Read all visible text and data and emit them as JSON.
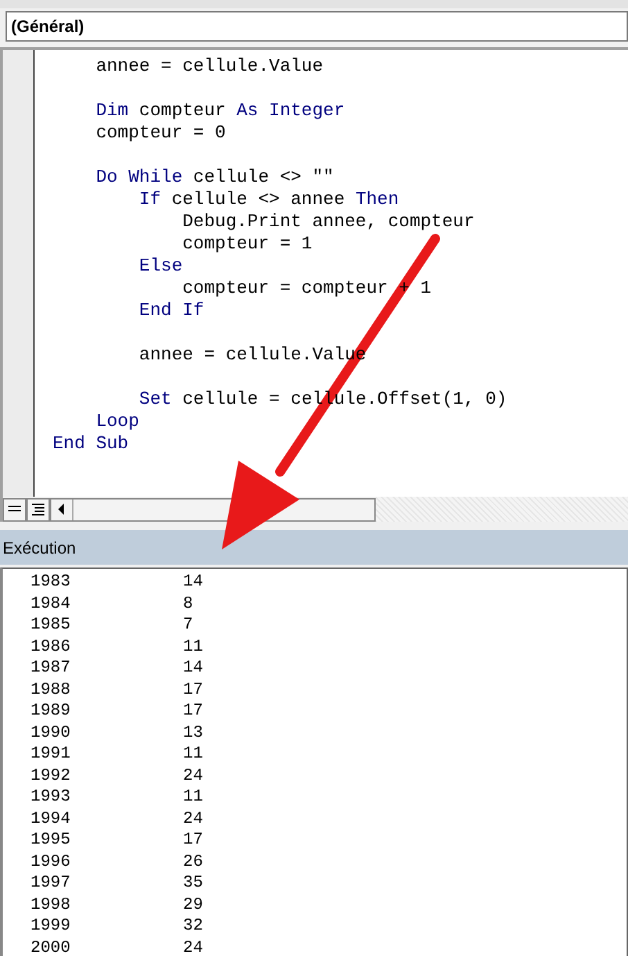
{
  "editor": {
    "procedure_dropdown": "(Général)",
    "code_lines": [
      {
        "kind": "code",
        "segments": [
          {
            "kind": "plain",
            "text": "    annee = cellule.Value"
          }
        ]
      },
      {
        "kind": "blank"
      },
      {
        "kind": "code",
        "segments": [
          {
            "kind": "keyword",
            "text": "    Dim"
          },
          {
            "kind": "plain",
            "text": " compteur "
          },
          {
            "kind": "keyword",
            "text": "As Integer"
          }
        ]
      },
      {
        "kind": "code",
        "segments": [
          {
            "kind": "plain",
            "text": "    compteur = 0"
          }
        ]
      },
      {
        "kind": "blank"
      },
      {
        "kind": "code",
        "segments": [
          {
            "kind": "keyword",
            "text": "    Do While"
          },
          {
            "kind": "plain",
            "text": " cellule <> \"\""
          }
        ]
      },
      {
        "kind": "code",
        "segments": [
          {
            "kind": "keyword",
            "text": "        If"
          },
          {
            "kind": "plain",
            "text": " cellule <> annee "
          },
          {
            "kind": "keyword",
            "text": "Then"
          }
        ]
      },
      {
        "kind": "code",
        "segments": [
          {
            "kind": "plain",
            "text": "            Debug.Print annee, compteur"
          }
        ]
      },
      {
        "kind": "code",
        "segments": [
          {
            "kind": "plain",
            "text": "            compteur = 1"
          }
        ]
      },
      {
        "kind": "code",
        "segments": [
          {
            "kind": "keyword",
            "text": "        Else"
          }
        ]
      },
      {
        "kind": "code",
        "segments": [
          {
            "kind": "plain",
            "text": "            compteur = compteur + 1"
          }
        ]
      },
      {
        "kind": "code",
        "segments": [
          {
            "kind": "keyword",
            "text": "        End If"
          }
        ]
      },
      {
        "kind": "blank"
      },
      {
        "kind": "code",
        "segments": [
          {
            "kind": "plain",
            "text": "        annee = cellule.Value"
          }
        ]
      },
      {
        "kind": "blank"
      },
      {
        "kind": "code",
        "segments": [
          {
            "kind": "keyword",
            "text": "        Set"
          },
          {
            "kind": "plain",
            "text": " cellule = cellule.Offset(1, 0)"
          }
        ]
      },
      {
        "kind": "code",
        "segments": [
          {
            "kind": "keyword",
            "text": "    Loop"
          }
        ]
      },
      {
        "kind": "code",
        "segments": [
          {
            "kind": "keyword",
            "text": "End Sub"
          }
        ]
      }
    ]
  },
  "immediate_window": {
    "title": "Exécution",
    "rows": [
      [
        "1983",
        "14"
      ],
      [
        "1984",
        "8"
      ],
      [
        "1985",
        "7"
      ],
      [
        "1986",
        "11"
      ],
      [
        "1987",
        "14"
      ],
      [
        "1988",
        "17"
      ],
      [
        "1989",
        "17"
      ],
      [
        "1990",
        "13"
      ],
      [
        "1991",
        "11"
      ],
      [
        "1992",
        "24"
      ],
      [
        "1993",
        "11"
      ],
      [
        "1994",
        "24"
      ],
      [
        "1995",
        "17"
      ],
      [
        "1996",
        "26"
      ],
      [
        "1997",
        "35"
      ],
      [
        "1998",
        "29"
      ],
      [
        "1999",
        "32"
      ],
      [
        "2000",
        "24"
      ]
    ]
  }
}
